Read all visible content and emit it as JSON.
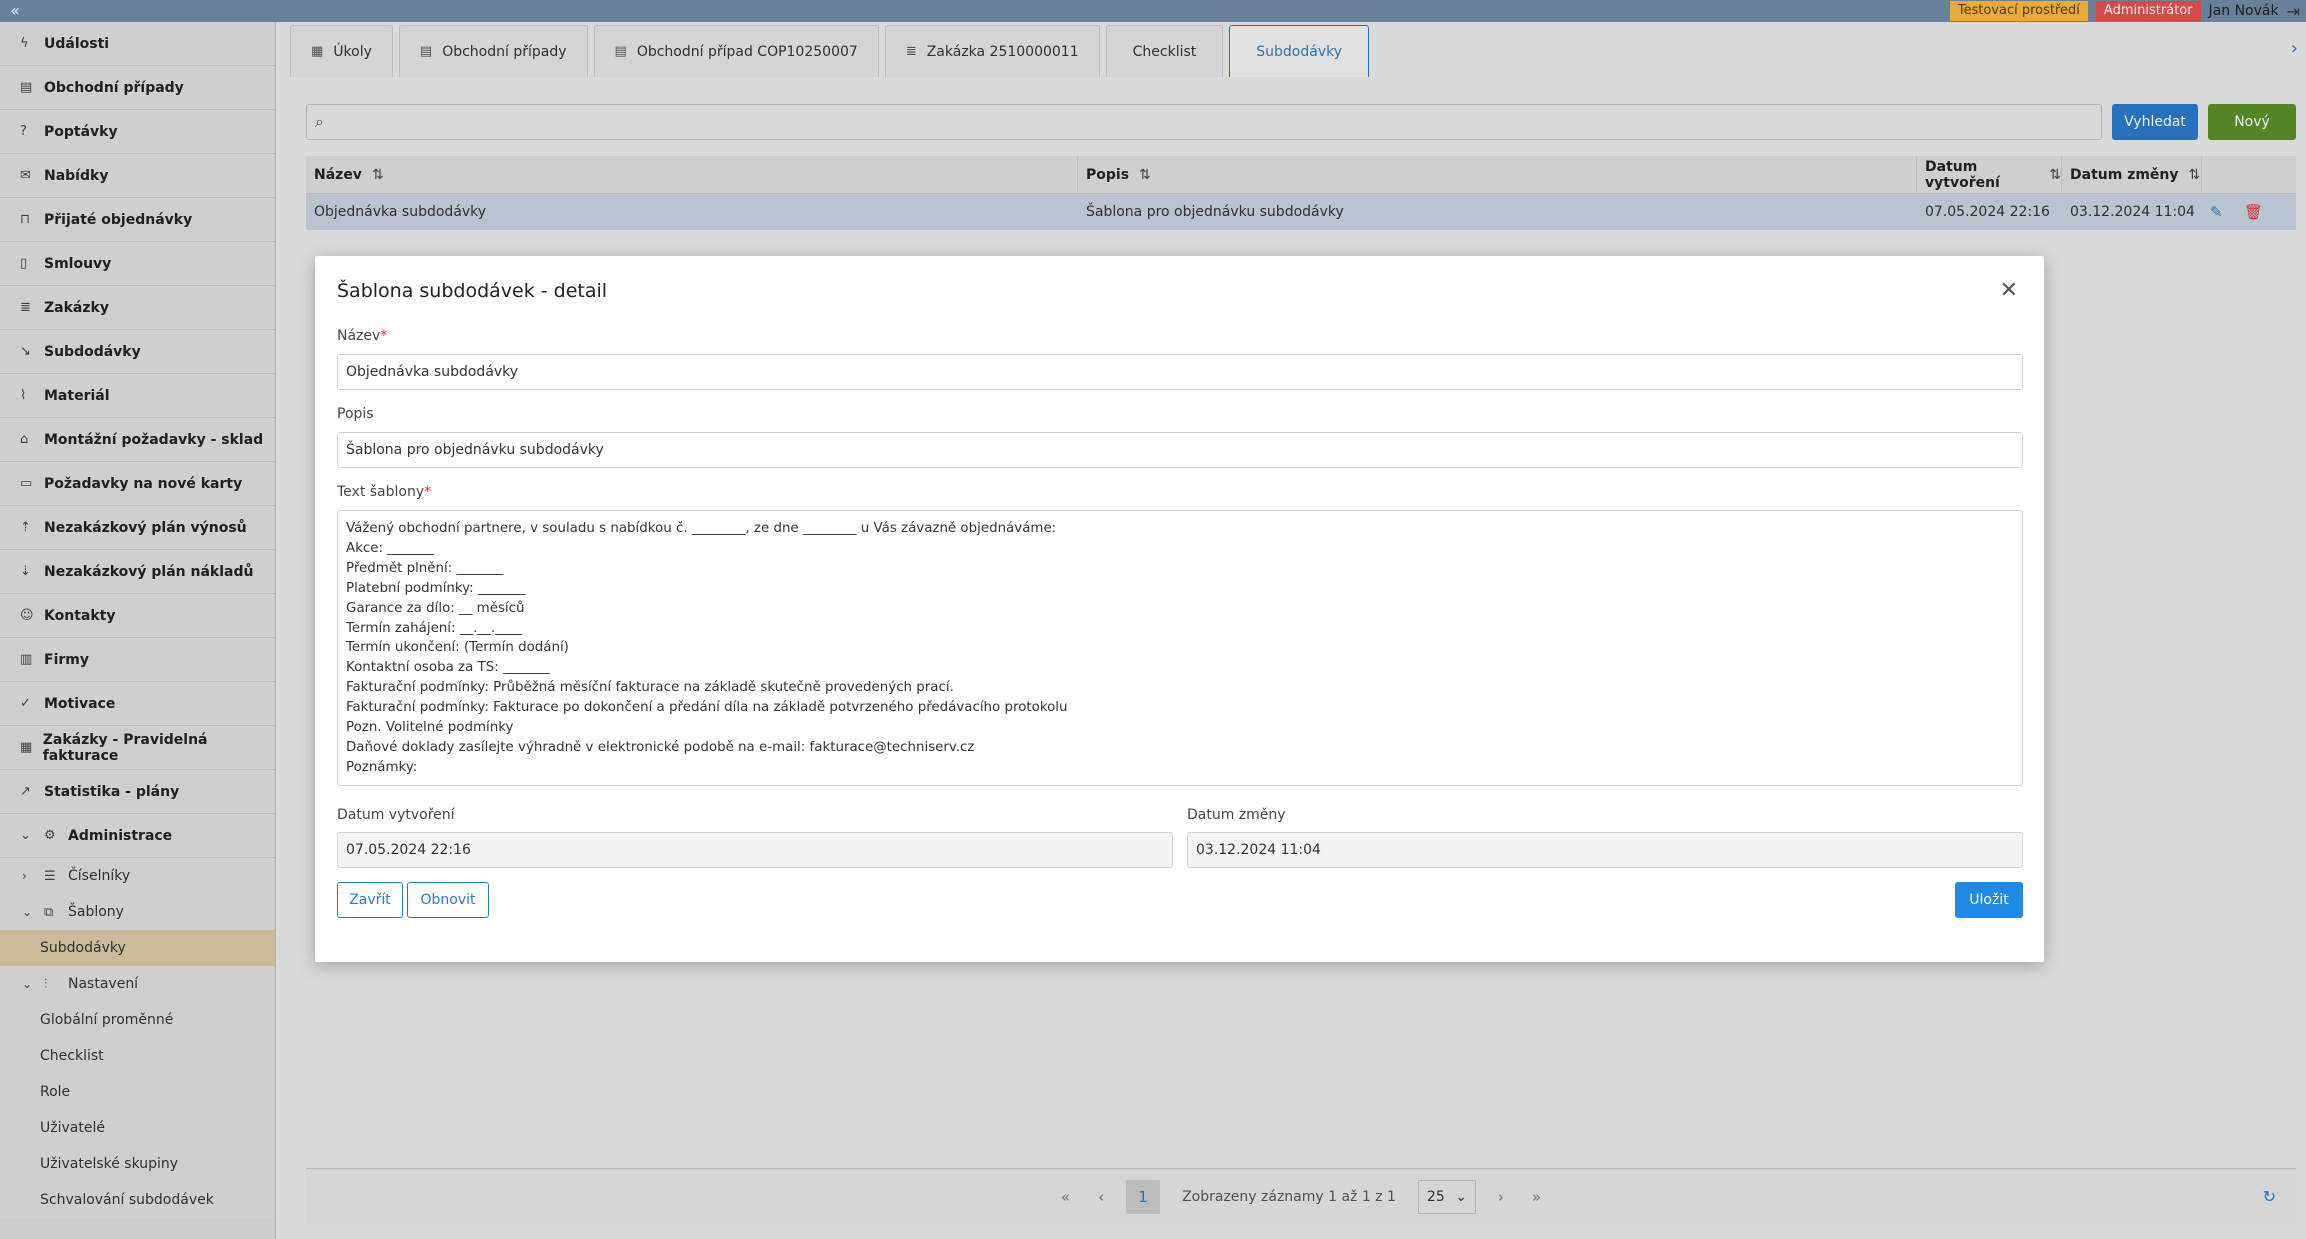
{
  "topbar": {
    "collapse_icon": "double-chevron-left-icon",
    "env_badge": "Testovací prostředí",
    "role_badge": "Administrátor",
    "user": "Jan Novák",
    "env_color": "#f6b73c",
    "role_color": "#e05050"
  },
  "sidebar": {
    "items": [
      {
        "label": "Události",
        "icon": "bolt-icon"
      },
      {
        "label": "Obchodní případy",
        "icon": "briefcase-icon"
      },
      {
        "label": "Poptávky",
        "icon": "question-icon"
      },
      {
        "label": "Nabídky",
        "icon": "envelope-icon"
      },
      {
        "label": "Přijaté objednávky",
        "icon": "bag-icon"
      },
      {
        "label": "Smlouvy",
        "icon": "document-icon"
      },
      {
        "label": "Zakázky",
        "icon": "list-doc-icon"
      },
      {
        "label": "Subdodávky",
        "icon": "arrow-down-right-icon"
      },
      {
        "label": "Materiál",
        "icon": "paperclip-icon"
      },
      {
        "label": "Montážní požadavky - sklad",
        "icon": "warehouse-icon"
      },
      {
        "label": "Požadavky na nové karty",
        "icon": "card-icon"
      },
      {
        "label": "Nezakázkový plán výnosů",
        "icon": "sort-up-icon"
      },
      {
        "label": "Nezakázkový plán nákladů",
        "icon": "sort-down-icon"
      },
      {
        "label": "Kontakty",
        "icon": "people-icon"
      },
      {
        "label": "Firmy",
        "icon": "building-icon"
      },
      {
        "label": "Motivace",
        "icon": "thumbs-up-icon"
      },
      {
        "label": "Zakázky - Pravidelná fakturace",
        "icon": "calendar-icon"
      },
      {
        "label": "Statistika - plány",
        "icon": "chart-icon"
      },
      {
        "label": "Administrace",
        "icon": "gear-icon"
      }
    ],
    "admin_children": {
      "ciselniky": "Číselníky",
      "sablony": "Šablony",
      "subdodavky": "Subdodávky",
      "nastaveni": "Nastavení",
      "nastaveni_children": [
        "Globální proměnné",
        "Checklist",
        "Role",
        "Uživatelé",
        "Uživatelské skupiny",
        "Schvalování subdodávek"
      ]
    }
  },
  "tabs": [
    {
      "label": "Úkoly",
      "icon": "calendar-icon"
    },
    {
      "label": "Obchodní případy",
      "icon": "briefcase-icon"
    },
    {
      "label": "Obchodní případ COP10250007",
      "icon": "briefcase-icon"
    },
    {
      "label": "Zakázka 2510000011",
      "icon": "list-doc-icon"
    },
    {
      "label": "Checklist",
      "icon": ""
    },
    {
      "label": "Subdodávky",
      "icon": ""
    }
  ],
  "search": {
    "placeholder": "",
    "search_btn": "Vyhledat",
    "new_btn": "Nový"
  },
  "table": {
    "columns": [
      "Název",
      "Popis",
      "Datum vytvoření",
      "Datum změny"
    ],
    "rows": [
      {
        "nazev": "Objednávka subdodávky",
        "popis": "Šablona pro objednávku subdodávky",
        "created": "07.05.2024 22:16",
        "changed": "03.12.2024 11:04"
      }
    ]
  },
  "pager": {
    "current": "1",
    "info": "Zobrazeny záznamy 1 až 1 z 1",
    "page_size": "25"
  },
  "modal": {
    "title": "Šablona subdodávek - detail",
    "name_label": "Název",
    "name_value": "Objednávka subdodávky",
    "desc_label": "Popis",
    "desc_value": "Šablona pro objednávku subdodávky",
    "text_label": "Text šablony",
    "text_lines": [
      "Vážený obchodní partnere, v souladu s nabídkou č. ________, ze dne ________ u Vás závazně objednáváme:",
      "Akce: _______",
      "Předmět plnění: _______",
      "Platební podmínky: _______",
      "Garance za dílo: __ měsíců",
      "Termín zahájení: __.__.____",
      "Termín ukončení: (Termín dodání)",
      "Kontaktní osoba za TS: _______",
      "Fakturační podmínky: Průběžná měsíční fakturace na základě skutečně provedených prací.",
      "Fakturační podmínky: Fakturace po dokončení a předání díla na základě potvrzeného předávacího protokolu",
      "Pozn. Volitelné podmínky",
      "Daňové doklady zasílejte výhradně v elektronické podobě na e-mail: fakturace@techniserv.cz",
      "Poznámky:"
    ],
    "created_label": "Datum vytvoření",
    "created_value": "07.05.2024 22:16",
    "changed_label": "Datum změny",
    "changed_value": "03.12.2024 11:04",
    "close_btn": "Zavřít",
    "refresh_btn": "Obnovit",
    "save_btn": "Uložit"
  }
}
